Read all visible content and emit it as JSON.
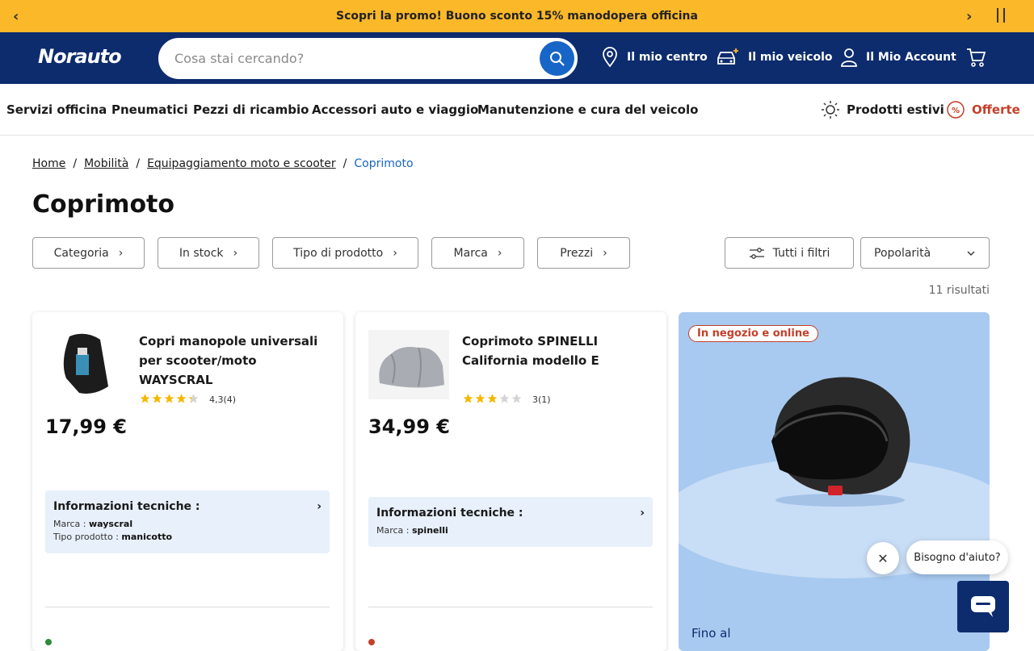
{
  "promo_bar": {
    "text": "Scopri la promo! Buono sconto 15% manodopera officina",
    "prev_icon": "chevron-left-icon",
    "next_icon": "chevron-right-icon",
    "pause_icon": "pause-icon"
  },
  "header": {
    "logo": {
      "part1": "Norauto"
    },
    "search": {
      "placeholder": "Cosa stai cercando?"
    },
    "nav": [
      {
        "label": "Il mio centro",
        "icon": "map-pin-icon"
      },
      {
        "label": "Il mio veicolo",
        "icon": "car-add-icon"
      },
      {
        "label": "Il Mio Account",
        "icon": "user-icon"
      }
    ],
    "cart_icon": "cart-icon"
  },
  "category_nav": {
    "items": [
      "Servizi officina",
      "Pneumatici",
      "Pezzi di ricambio",
      "Accessori auto e viaggio",
      "Manutenzione e cura del veicolo"
    ],
    "summer": "Prodotti estivi",
    "offers": "Offerte"
  },
  "breadcrumb": {
    "items": [
      "Home",
      "Mobilità",
      "Equipaggiamento moto e scooter"
    ],
    "current": "Coprimoto"
  },
  "page_title": "Coprimoto",
  "filters": {
    "items": [
      "Categoria",
      "In stock",
      "Tipo di prodotto",
      "Marca",
      "Prezzi"
    ],
    "all_filters": "Tutti i filtri",
    "sort": "Popolarità",
    "results": "11 risultati"
  },
  "products": [
    {
      "title": "Copri manopole universali per scooter/moto WAYSCRAL",
      "rating": "4,3(4)",
      "stars": 4.3,
      "price": "17,99 €",
      "tech_title": "Informazioni tecniche :",
      "specs": [
        {
          "label": "Marca : ",
          "value": "wayscral"
        },
        {
          "label": "Tipo prodotto : ",
          "value": "manicotto"
        }
      ],
      "availability_color": "#2e8b3a"
    },
    {
      "title": "Coprimoto SPINELLI California modello E",
      "rating": "3(1)",
      "stars": 3,
      "price": "34,99 €",
      "tech_title": "Informazioni tecniche :",
      "specs": [
        {
          "label": "Marca : ",
          "value": "spinelli"
        }
      ],
      "availability_color": "#c4402a"
    }
  ],
  "promo_card": {
    "badge": "In negozio e online",
    "fino": "Fino al"
  },
  "chat": {
    "bubble": "Bisogno d'aiuto?"
  },
  "colors": {
    "brand_navy": "#0d2c6e",
    "promo_yellow": "#fbb829",
    "accent_blue": "#1766c7",
    "offer_red": "#c4402a"
  }
}
